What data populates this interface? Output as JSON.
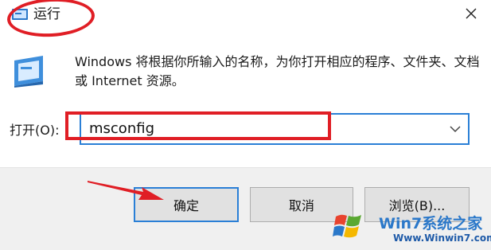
{
  "window": {
    "title": "运行",
    "close_glyph": "×"
  },
  "dialog": {
    "description": "Windows 将根据你所输入的名称，为你打开相应的程序、文件夹、文档或 Internet 资源。",
    "open_label": "打开(O):",
    "command_value": "msconfig"
  },
  "buttons": {
    "ok": "确定",
    "cancel": "取消",
    "browse": "浏览(B)..."
  },
  "watermark": {
    "name": "Win7系统之家",
    "url": "Www.Winwin7.com"
  },
  "colors": {
    "accent": "#2a7fd6",
    "annotation": "#e01e25",
    "footer_bg": "#f0f0f0"
  },
  "icons": [
    "run-app-icon",
    "close-icon",
    "run-program-icon",
    "chevron-down-icon",
    "windows-logo-icon",
    "red-arrow-icon"
  ]
}
